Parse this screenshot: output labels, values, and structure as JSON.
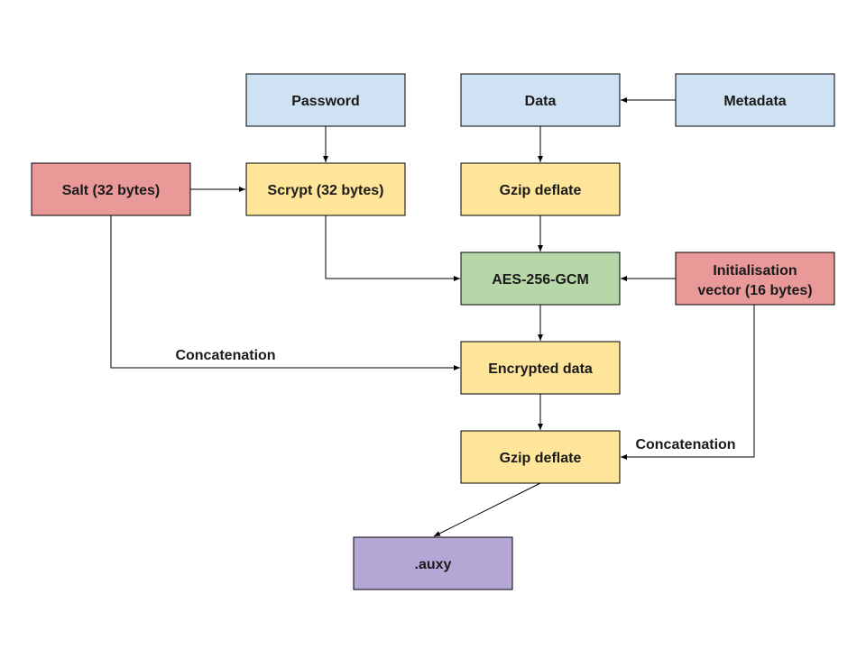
{
  "colors": {
    "blue": "#cfe2f3",
    "yellow": "#ffe599",
    "red": "#ea9999",
    "green": "#b6d7a8",
    "purple": "#b4a7d6"
  },
  "nodes": {
    "password": {
      "label": "Password",
      "color": "blue"
    },
    "data": {
      "label": "Data",
      "color": "blue"
    },
    "metadata": {
      "label": "Metadata",
      "color": "blue"
    },
    "salt": {
      "label": "Salt (32 bytes)",
      "color": "red"
    },
    "scrypt": {
      "label": "Scrypt (32 bytes)",
      "color": "yellow"
    },
    "gzip1": {
      "label": "Gzip deflate",
      "color": "yellow"
    },
    "aes": {
      "label": "AES-256-GCM",
      "color": "green"
    },
    "iv": {
      "label1": "Initialisation",
      "label2": "vector (16 bytes)",
      "color": "red"
    },
    "encrypted": {
      "label": "Encrypted data",
      "color": "yellow"
    },
    "gzip2": {
      "label": "Gzip deflate",
      "color": "yellow"
    },
    "auxy": {
      "label": ".auxy",
      "color": "purple"
    }
  },
  "edge_labels": {
    "concat1": "Concatenation",
    "concat2": "Concatenation"
  },
  "edges": [
    [
      "metadata",
      "data"
    ],
    [
      "password",
      "scrypt"
    ],
    [
      "salt",
      "scrypt"
    ],
    [
      "data",
      "gzip1"
    ],
    [
      "scrypt",
      "aes"
    ],
    [
      "gzip1",
      "aes"
    ],
    [
      "iv",
      "aes"
    ],
    [
      "aes",
      "encrypted"
    ],
    [
      "salt",
      "encrypted"
    ],
    [
      "encrypted",
      "gzip2"
    ],
    [
      "iv",
      "gzip2"
    ],
    [
      "gzip2",
      "auxy"
    ]
  ]
}
